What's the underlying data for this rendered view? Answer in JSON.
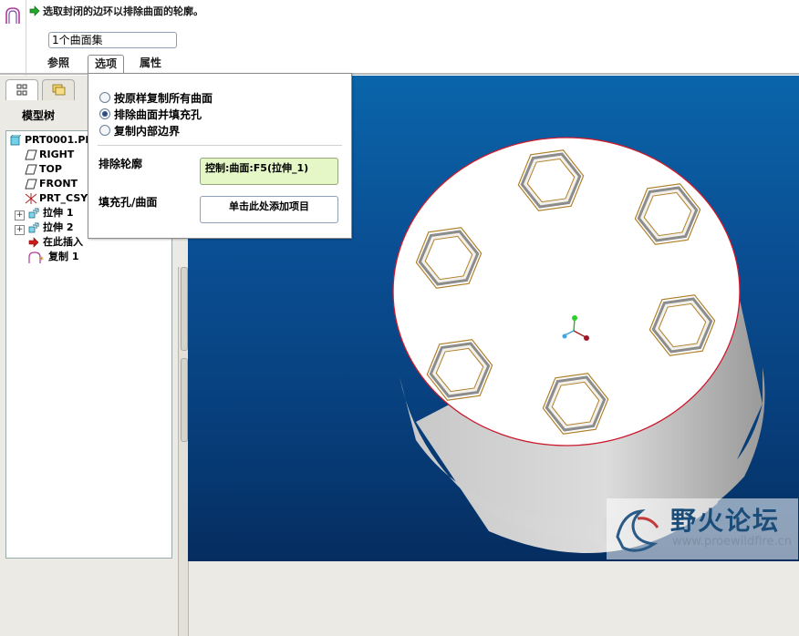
{
  "dashboard": {
    "feature_icon": "copy-surface-icon",
    "prompt_icon": "green-arrow-icon",
    "prompt": "选取封闭的边环以排除曲面的轮廓。",
    "collector_value": "1个曲面集",
    "tabs": [
      {
        "label": "参照"
      },
      {
        "label": "选项"
      },
      {
        "label": "属性"
      }
    ]
  },
  "options_panel": {
    "radios": [
      {
        "label": "按原样复制所有曲面",
        "selected": false
      },
      {
        "label": "排除曲面并填充孔",
        "selected": true
      },
      {
        "label": "复制内部边界",
        "selected": false
      }
    ],
    "exclude_label": "排除轮廓",
    "exclude_value": "控制:曲面:F5(拉伸_1)",
    "fill_label": "填充孔/曲面",
    "fill_placeholder": "单击此处添加项目"
  },
  "model_tree": {
    "header": "模型树",
    "items": [
      {
        "label": "PRT0001.PR",
        "icon": "part-icon"
      },
      {
        "label": "RIGHT",
        "icon": "datum-plane-icon"
      },
      {
        "label": "TOP",
        "icon": "datum-plane-icon"
      },
      {
        "label": "FRONT",
        "icon": "datum-plane-icon"
      },
      {
        "label": "PRT_CSY",
        "icon": "coordinate-system-icon"
      },
      {
        "label": "拉伸 1",
        "icon": "extrude-icon"
      },
      {
        "label": "拉伸 2",
        "icon": "extrude-icon"
      },
      {
        "label": "在此插入",
        "icon": "insert-here-arrow-icon"
      },
      {
        "label": "复制 1",
        "icon": "copy-surface-icon"
      }
    ]
  },
  "watermark": {
    "title": "野火论坛",
    "url": "www.proewildfire.cn"
  },
  "colors": {
    "viewport_top": "#0a65aa",
    "viewport_bottom": "#052d60",
    "exclude_box_fill": "#e5f6c7",
    "model_edge": "#cc1a2e"
  }
}
